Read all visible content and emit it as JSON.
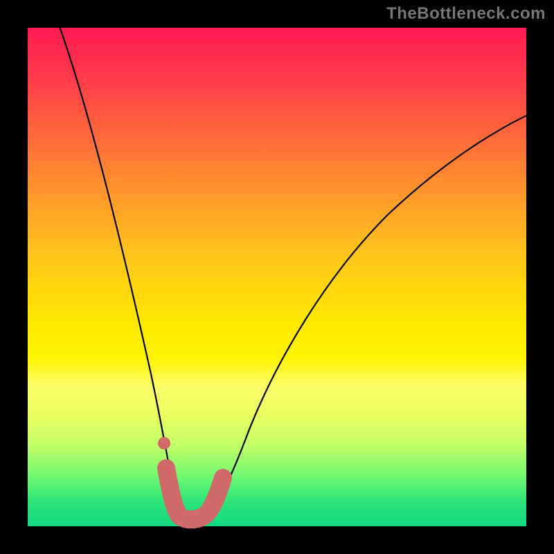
{
  "watermark": "TheBottleneck.com",
  "chart_data": {
    "type": "line",
    "title": "",
    "xlabel": "",
    "ylabel": "",
    "xlim": [
      0,
      100
    ],
    "ylim": [
      0,
      100
    ],
    "series": [
      {
        "name": "bottleneck-curve",
        "x": [
          6,
          10,
          14,
          18,
          22,
          25,
          27,
          29,
          30,
          32,
          34,
          37,
          40,
          44,
          50,
          58,
          66,
          76,
          88,
          100
        ],
        "values": [
          100,
          86,
          70,
          54,
          36,
          20,
          10,
          4,
          2,
          2,
          3,
          7,
          13,
          22,
          34,
          46,
          55,
          63,
          70,
          75
        ]
      }
    ],
    "highlight": {
      "name": "optimal-zone",
      "x_range": [
        27,
        37
      ],
      "marker_dot_x": 27.5
    },
    "background_gradient_stops": [
      {
        "pos": 0,
        "color": "#ff1a52"
      },
      {
        "pos": 50,
        "color": "#ffe600"
      },
      {
        "pos": 100,
        "color": "#12d880"
      }
    ]
  }
}
